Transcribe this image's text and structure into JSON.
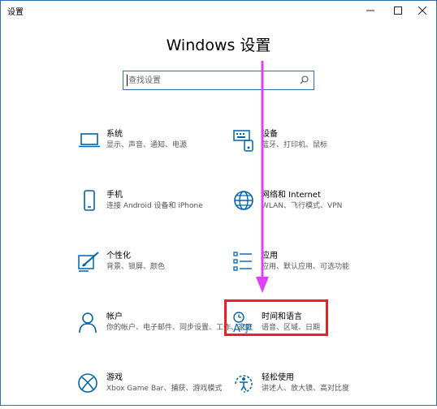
{
  "window": {
    "title": "设置",
    "controls": {
      "minimize": "—",
      "maximize": "☐",
      "close": "✕"
    }
  },
  "page": {
    "heading": "Windows 设置",
    "search_placeholder": "查找设置"
  },
  "tiles": [
    {
      "name": "系统",
      "desc": "显示、声音、通知、电源",
      "icon": "laptop-icon"
    },
    {
      "name": "设备",
      "desc": "蓝牙、打印机、鼠标",
      "icon": "keyboard-icon"
    },
    {
      "name": "手机",
      "desc": "连接 Android 设备和 iPhone",
      "icon": "phone-icon"
    },
    {
      "name": "网络和 Internet",
      "desc": "WLAN、飞行模式、VPN",
      "icon": "globe-icon"
    },
    {
      "name": "个性化",
      "desc": "背景、锁屏、颜色",
      "icon": "paintbrush-icon"
    },
    {
      "name": "应用",
      "desc": "应用、默认应用、可选功能",
      "icon": "apps-list-icon"
    },
    {
      "name": "帐户",
      "desc": "你的帐户、电子邮件、同步设置、工作、家庭",
      "icon": "person-icon"
    },
    {
      "name": "时间和语言",
      "desc": "语音、区域、日期",
      "icon": "time-language-icon"
    },
    {
      "name": "游戏",
      "desc": "Xbox Game Bar、捕获、游戏模式",
      "icon": "xbox-icon"
    },
    {
      "name": "轻松使用",
      "desc": "讲述人、放大镜、高对比度",
      "icon": "ease-of-access-icon"
    }
  ],
  "colors": {
    "accent": "#0063b1",
    "highlight_box": "#e8212b",
    "arrow": "#e040fb"
  }
}
